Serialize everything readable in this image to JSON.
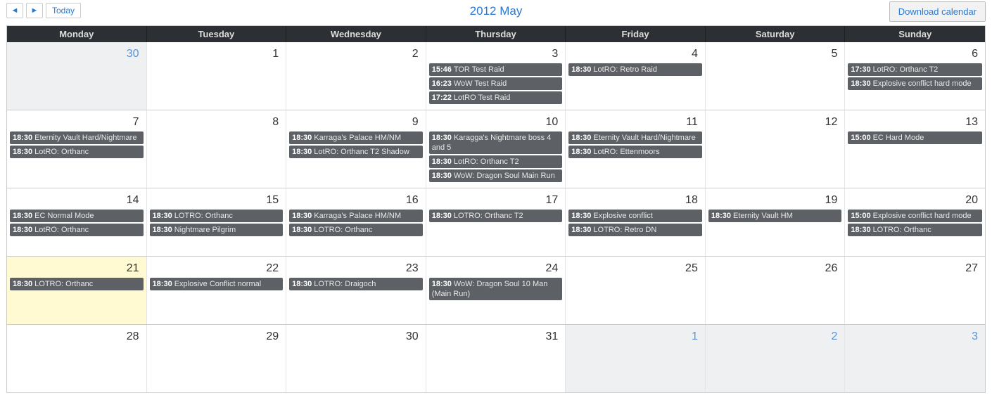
{
  "nav": {
    "prev": "◄",
    "next": "►",
    "today": "Today",
    "title": "2012 May",
    "download": "Download calendar"
  },
  "day_headers": [
    "Monday",
    "Tuesday",
    "Wednesday",
    "Thursday",
    "Friday",
    "Saturday",
    "Sunday"
  ],
  "weeks": [
    [
      {
        "num": "30",
        "out": true,
        "events": []
      },
      {
        "num": "1",
        "events": []
      },
      {
        "num": "2",
        "events": []
      },
      {
        "num": "3",
        "events": [
          {
            "time": "15:46",
            "title": "TOR Test Raid"
          },
          {
            "time": "16:23",
            "title": "WoW Test Raid"
          },
          {
            "time": "17:22",
            "title": "LotRO Test Raid"
          }
        ]
      },
      {
        "num": "4",
        "events": [
          {
            "time": "18:30",
            "title": "LotRO: Retro Raid"
          }
        ]
      },
      {
        "num": "5",
        "events": []
      },
      {
        "num": "6",
        "events": [
          {
            "time": "17:30",
            "title": "LotRO: Orthanc T2"
          },
          {
            "time": "18:30",
            "title": "Explosive conflict hard mode"
          }
        ]
      }
    ],
    [
      {
        "num": "7",
        "events": [
          {
            "time": "18:30",
            "title": "Eternity Vault Hard/Nightmare"
          },
          {
            "time": "18:30",
            "title": "LotRO: Orthanc"
          }
        ]
      },
      {
        "num": "8",
        "events": []
      },
      {
        "num": "9",
        "events": [
          {
            "time": "18:30",
            "title": "Karraga's Palace HM/NM"
          },
          {
            "time": "18:30",
            "title": "LotRO: Orthanc T2 Shadow"
          }
        ]
      },
      {
        "num": "10",
        "events": [
          {
            "time": "18:30",
            "title": "Karagga's Nightmare boss 4 and 5"
          },
          {
            "time": "18:30",
            "title": "LotRO: Orthanc T2"
          },
          {
            "time": "18:30",
            "title": "WoW: Dragon Soul Main Run"
          }
        ]
      },
      {
        "num": "11",
        "events": [
          {
            "time": "18:30",
            "title": "Eternity Vault Hard/Nightmare"
          },
          {
            "time": "18:30",
            "title": "LotRO: Ettenmoors"
          }
        ]
      },
      {
        "num": "12",
        "events": []
      },
      {
        "num": "13",
        "events": [
          {
            "time": "15:00",
            "title": "EC Hard Mode"
          }
        ]
      }
    ],
    [
      {
        "num": "14",
        "events": [
          {
            "time": "18:30",
            "title": "EC Normal Mode"
          },
          {
            "time": "18:30",
            "title": "LotRO: Orthanc"
          }
        ]
      },
      {
        "num": "15",
        "events": [
          {
            "time": "18:30",
            "title": "LOTRO: Orthanc"
          },
          {
            "time": "18:30",
            "title": "Nightmare Pilgrim"
          }
        ]
      },
      {
        "num": "16",
        "events": [
          {
            "time": "18:30",
            "title": "Karraga's Palace HM/NM"
          },
          {
            "time": "18:30",
            "title": "LOTRO: Orthanc"
          }
        ]
      },
      {
        "num": "17",
        "events": [
          {
            "time": "18:30",
            "title": "LOTRO: Orthanc T2"
          }
        ]
      },
      {
        "num": "18",
        "events": [
          {
            "time": "18:30",
            "title": "Explosive conflict"
          },
          {
            "time": "18:30",
            "title": "LOTRO: Retro DN"
          }
        ]
      },
      {
        "num": "19",
        "events": [
          {
            "time": "18:30",
            "title": "Eternity Vault HM"
          }
        ]
      },
      {
        "num": "20",
        "events": [
          {
            "time": "15:00",
            "title": "Explosive conflict hard mode"
          },
          {
            "time": "18:30",
            "title": "LOTRO: Orthanc"
          }
        ]
      }
    ],
    [
      {
        "num": "21",
        "today": true,
        "events": [
          {
            "time": "18:30",
            "title": "LOTRO: Orthanc"
          }
        ]
      },
      {
        "num": "22",
        "events": [
          {
            "time": "18:30",
            "title": "Explosive Conflict normal"
          }
        ]
      },
      {
        "num": "23",
        "events": [
          {
            "time": "18:30",
            "title": "LOTRO: Draigoch"
          }
        ]
      },
      {
        "num": "24",
        "events": [
          {
            "time": "18:30",
            "title": "WoW: Dragon Soul 10 Man (Main Run)"
          }
        ]
      },
      {
        "num": "25",
        "events": []
      },
      {
        "num": "26",
        "events": []
      },
      {
        "num": "27",
        "events": []
      }
    ],
    [
      {
        "num": "28",
        "events": []
      },
      {
        "num": "29",
        "events": []
      },
      {
        "num": "30",
        "events": []
      },
      {
        "num": "31",
        "events": []
      },
      {
        "num": "1",
        "out": true,
        "events": []
      },
      {
        "num": "2",
        "out": true,
        "events": []
      },
      {
        "num": "3",
        "out": true,
        "events": []
      }
    ]
  ]
}
